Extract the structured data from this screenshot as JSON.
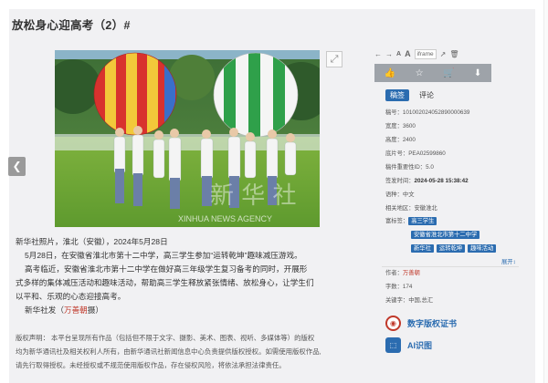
{
  "page": {
    "title": "放松身心迎高考（2）#"
  },
  "photo": {
    "watermark_cn": "新 华 社",
    "watermark_en": "XINHUA NEWS AGENCY"
  },
  "caption": {
    "line1": "新华社照片，淮北（安徽），2024年5月28日",
    "line2": "5月28日，在安徽省淮北市第十二中学，高三学生参加“运转乾坤”趣味减压游戏。",
    "line3": "高考临近，安徽省淮北市第十二中学在做好高三年级学生复习备考的同时，开展形",
    "line4": "式多样的集体减压活动和趣味活动，帮助高三学生释放紧张情绪、放松身心，让学生们",
    "line5": "以平和、乐观的心态迎接高考。",
    "line6_prefix": "新华社发（",
    "line6_author": "万善朝",
    "line6_suffix": "摄）"
  },
  "tools": {
    "iframe": "iframe"
  },
  "tabs": {
    "active": "稿签",
    "inactive": "评论"
  },
  "meta": {
    "id_label": "稿号：",
    "id": "101002024052890000639",
    "w_label": "宽度：",
    "w": "3600",
    "h_label": "高度：",
    "h": "2400",
    "film_label": "底片号：",
    "film": "PEA02599860",
    "level_label": "稿件重要性ID：",
    "level": "5.0",
    "time_label": "签发时间：",
    "time": "2024-05-28 15:38:42",
    "lang_label": "语种：",
    "lang": "中文",
    "place_label": "相关地区：",
    "place": "安徽淮北",
    "tag_label": "富标签：",
    "tags": [
      "高三学生",
      "安徽省淮北市第十二中学",
      "新华社",
      "运转乾坤",
      "趣味活动"
    ],
    "more": "展开",
    "author_label": "作者：",
    "author": "万善朝",
    "words_label": "字数：",
    "words": "174",
    "kw_label": "关键字：",
    "kw": "中国,总汇"
  },
  "services": {
    "cert": "数字版权证书",
    "ai": "AI识图"
  },
  "notice": {
    "l1": "版权声明：  本平台呈现所有作品（包括但不限于文字、摄影、美术、图表、视听、多媒体等）的版权",
    "l2": "均为新华通讯社及相关权利人所有，由新华通讯社新闻信息中心负责提供版权授权。如需使用版权作品,",
    "l3": "请先行取得授权。未经授权或不规范使用版权作品，存在侵权风险，将依法承担法律责任。"
  }
}
